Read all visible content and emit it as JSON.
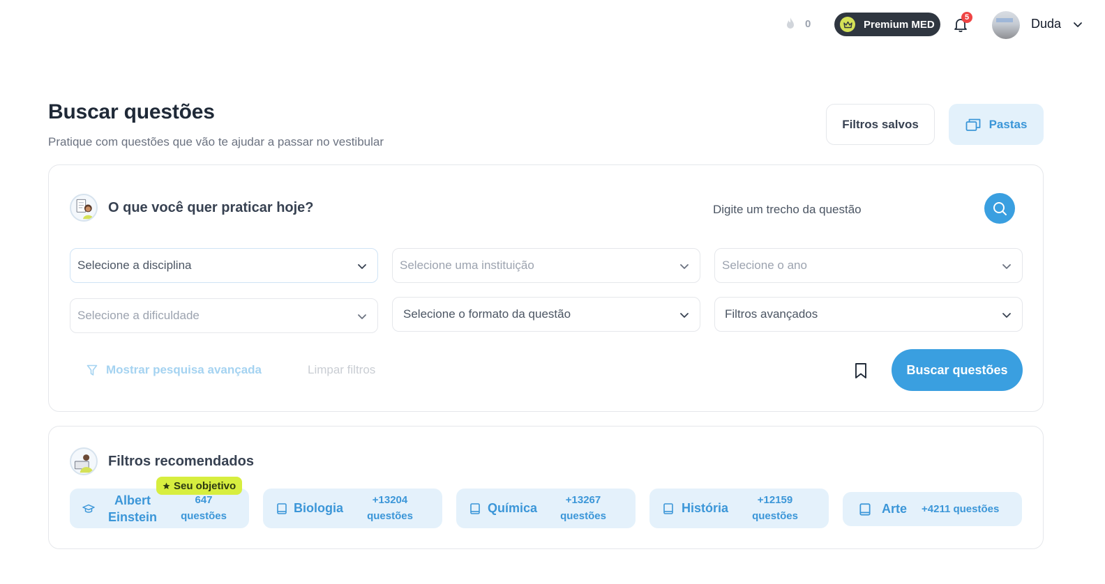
{
  "topbar": {
    "streak_count": "0",
    "premium_label": "Premium MED",
    "notification_count": "5",
    "username": "Duda"
  },
  "header": {
    "title": "Buscar questões",
    "subtitle": "Pratique com questões que vão te ajudar a passar no vestibular",
    "saved_filters_label": "Filtros salvos",
    "folders_label": "Pastas"
  },
  "search": {
    "title": "O que você quer praticar hoje?",
    "text_placeholder": "Digite um trecho da questão",
    "selects": {
      "discipline": "Selecione a disciplina",
      "institution": "Selecione uma instituição",
      "year": "Selecione o ano",
      "difficulty": "Selecione a dificuldade",
      "format": "Selecione o formato da questão",
      "advanced": "Filtros avançados"
    },
    "advanced_link": "Mostrar pesquisa avançada",
    "clear_link": "Limpar filtros",
    "submit_label": "Buscar questões"
  },
  "recommended": {
    "title": "Filtros recomendados",
    "goal_badge": "Seu objetivo",
    "chips": [
      {
        "label_line1": "Albert",
        "label_line2": "Einstein",
        "count_line1": "647",
        "count_line2": "questões"
      },
      {
        "label": "Biologia",
        "count_line1": "+13204",
        "count_line2": "questões"
      },
      {
        "label": "Química",
        "count_line1": "+13267",
        "count_line2": "questões"
      },
      {
        "label": "História",
        "count_line1": "+12159",
        "count_line2": "questões"
      },
      {
        "label": "Arte",
        "count": "+4211 questões"
      }
    ]
  },
  "colors": {
    "accent": "#3a9fe0",
    "accent_light": "#e4f1fb",
    "premium_bg": "#2f3640",
    "goal_badge": "#d7ee3f",
    "badge_red": "#ef4444"
  },
  "icons": [
    "flame-icon",
    "crown-icon",
    "bell-icon",
    "chevron-down-icon",
    "folders-icon",
    "search-icon",
    "filter-icon",
    "bookmark-icon",
    "graduation-cap-icon",
    "book-icon",
    "star-icon"
  ]
}
